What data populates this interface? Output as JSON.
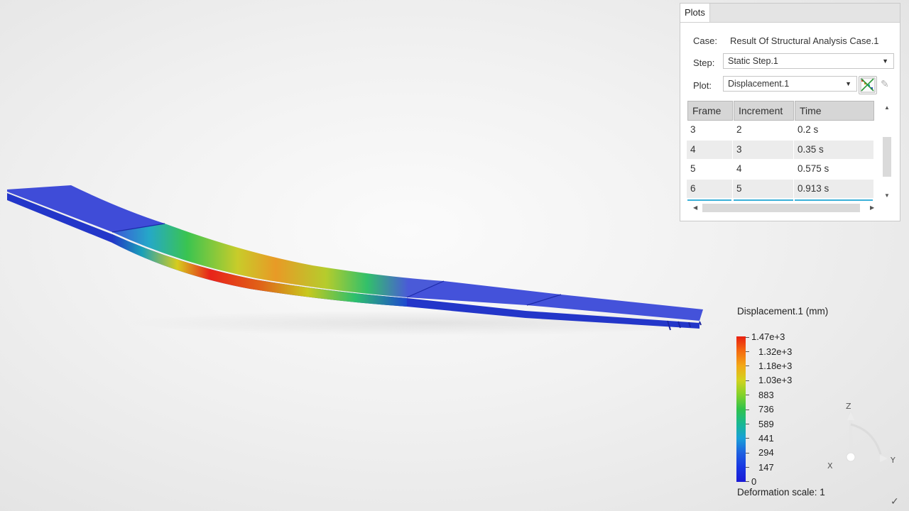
{
  "plots_panel": {
    "tab_label": "Plots",
    "case_label": "Case:",
    "case_value": "Result Of Structural Analysis Case.1",
    "step_label": "Step:",
    "step_value": "Static Step.1",
    "plot_label": "Plot:",
    "plot_value": "Displacement.1",
    "table": {
      "headers": [
        "Frame",
        "Increment",
        "Time"
      ],
      "rows": [
        [
          "3",
          "2",
          "0.2 s"
        ],
        [
          "4",
          "3",
          "0.35 s"
        ],
        [
          "5",
          "4",
          "0.575 s"
        ],
        [
          "6",
          "5",
          "0.913 s"
        ]
      ]
    }
  },
  "legend": {
    "title": "Displacement.1 (mm)",
    "labels": [
      "1.47e+3",
      "1.32e+3",
      "1.18e+3",
      "1.03e+3",
      "883",
      "736",
      "589",
      "441",
      "294",
      "147",
      "0"
    ],
    "deformation_scale": "Deformation scale: 1"
  },
  "axis_triad": {
    "z": "Z",
    "x": "X",
    "y": "Y"
  },
  "icons": {
    "plot_tool": "plot-display-icon",
    "edit": "pencil-icon",
    "corner": "check-icon"
  },
  "colors": {
    "beam_base": "#3a46d6",
    "max_displacement": "#e82010",
    "selection": "#3bb0d8"
  }
}
